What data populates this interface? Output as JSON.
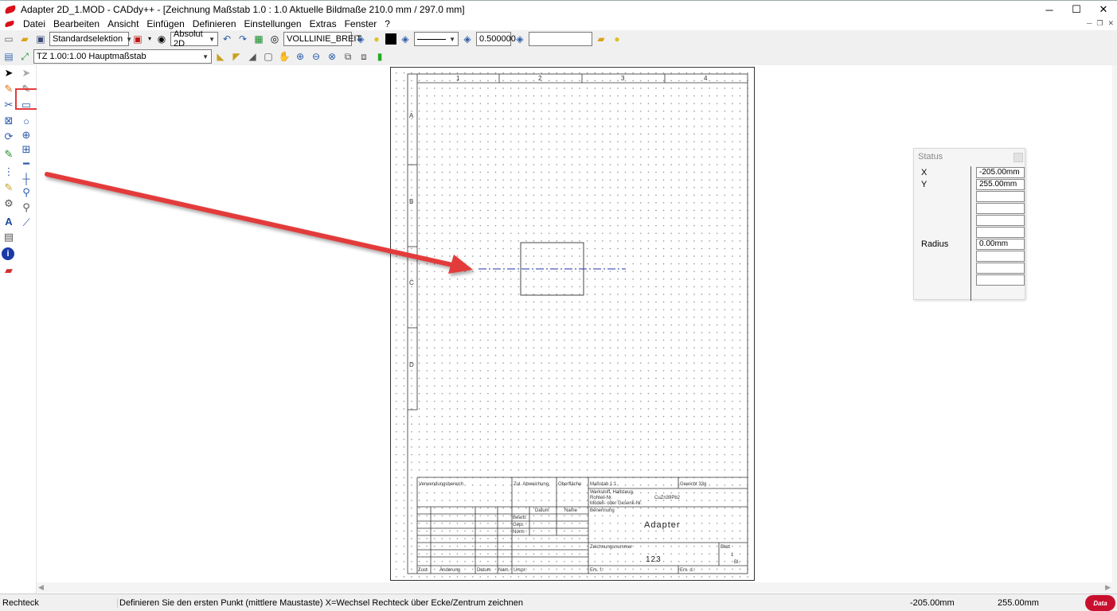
{
  "window": {
    "title": "Adapter 2D_1.MOD - CADdy++ - [Zeichnung   Maßstab 1.0 : 1.0   Aktuelle Bildmaße 210.0 mm / 297.0 mm]",
    "minimize": "─",
    "maximize": "☐",
    "close": "✕"
  },
  "menu": [
    "Datei",
    "Bearbeiten",
    "Ansicht",
    "Einfügen",
    "Definieren",
    "Einstellungen",
    "Extras",
    "Fenster",
    "?"
  ],
  "toolbar1": {
    "selection_mode": "Standardselektion",
    "coord_mode": "Absolut 2D",
    "linetype": "VOLLLINIE_BREIT",
    "line_width": "0.500000",
    "layer_field": ""
  },
  "toolbar2": {
    "scale_combo": "TZ 1.00:1.00 Hauptmaßstab"
  },
  "drawing": {
    "columns": [
      "1",
      "2",
      "3",
      "4"
    ],
    "rows": [
      "A",
      "B",
      "C",
      "D"
    ],
    "titleblock": {
      "verwendungsbereich": "Verwendungsbereich",
      "zul_abweichung": "Zul. Abweichung",
      "oberflaeche": "Oberfläche",
      "massstab": "Maßstab   1:1",
      "gewicht": "Gewicht   33g",
      "werkstoff": "Werkstoff, Halbzeug",
      "rohteil": "Rohteil-Nr.",
      "material": "CuZn39Pb2",
      "modell": "Modell- oder Gesenk-Nr.",
      "benennung": "Benennung",
      "name": "Adapter",
      "datum_header": "Datum",
      "name_header": "Name",
      "bearb": "Bearb.",
      "gepr": "Gepr.",
      "norm": "Norm",
      "zeichnungsnummer": "Zeichnungsnummer",
      "number": "123",
      "blatt": "Blatt",
      "blatt_nr": "1",
      "blatt_bl": "Bl.",
      "zust": "Zust.",
      "aenderung": "Änderung",
      "datum": "Datum",
      "nam": "Nam.",
      "urspr": "Urspr.",
      "ers_f": "Ers. f.:",
      "ers_d": "Ers. d.:"
    }
  },
  "status_panel": {
    "title": "Status",
    "x_label": "X",
    "x_value": "-205.00mm",
    "y_label": "Y",
    "y_value": "255.00mm",
    "radius_label": "Radius",
    "radius_value": "0.00mm"
  },
  "statusbar": {
    "mode": "Rechteck",
    "message": "Definieren Sie den ersten Punkt (mittlere Maustaste) X=Wechsel Rechteck über Ecke/Zentrum zeichnen",
    "x": "-205.00mm",
    "y": "255.00mm",
    "logo": "Data Solid"
  },
  "colors": {
    "highlight": "#e33b3b",
    "centerline": "#1f2ea8",
    "brand": "#c8102e"
  }
}
